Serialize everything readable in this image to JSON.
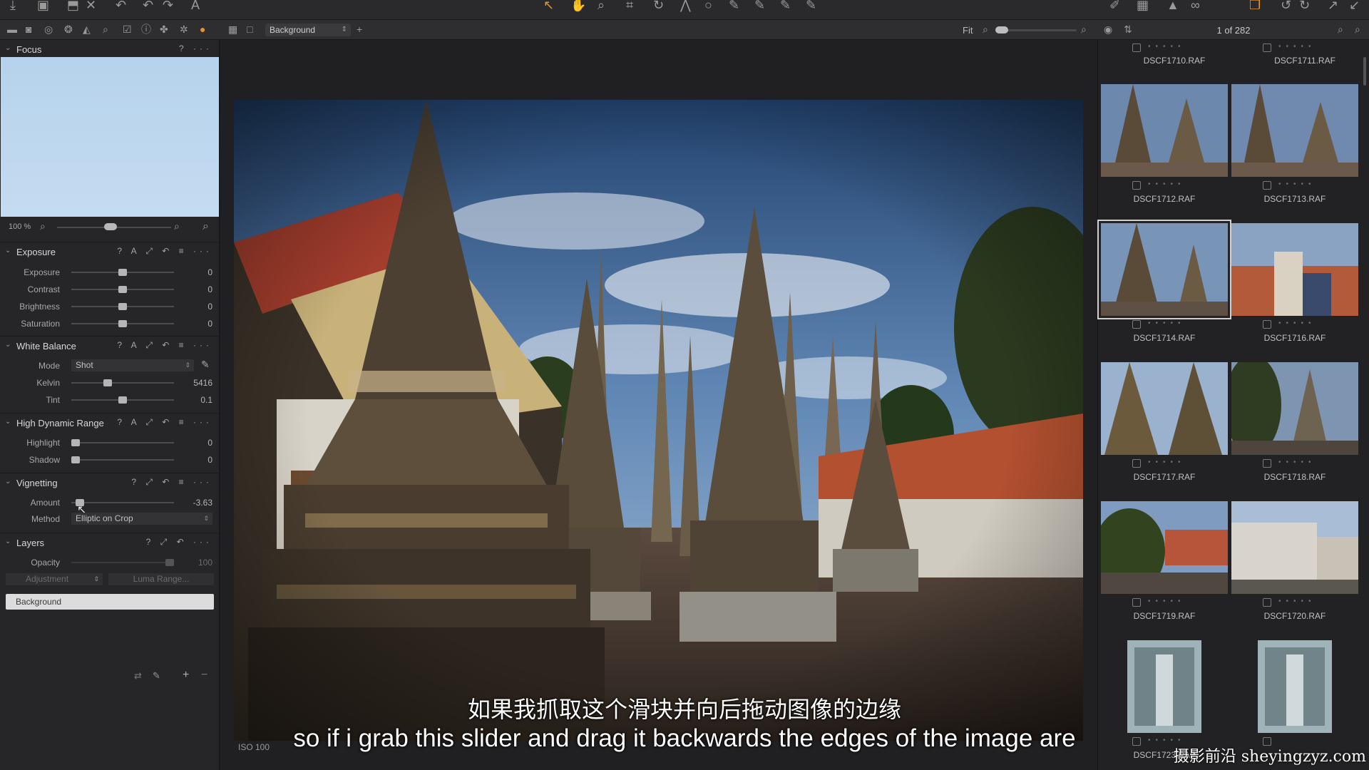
{
  "toolbar": {
    "layer_name": "Background",
    "fit_label": "Fit",
    "counter": "1 of 282"
  },
  "left_panel": {
    "focus": {
      "title": "Focus",
      "tools": "? ···",
      "zoom_value": "100 %"
    },
    "exposure": {
      "title": "Exposure",
      "tools": "? A ⤢ ↶ ≡ ···",
      "rows": [
        {
          "label": "Exposure",
          "value": "0"
        },
        {
          "label": "Contrast",
          "value": "0"
        },
        {
          "label": "Brightness",
          "value": "0"
        },
        {
          "label": "Saturation",
          "value": "0"
        }
      ]
    },
    "white_balance": {
      "title": "White Balance",
      "tools": "? A ⤢ ↶ ≡ ···",
      "mode_label": "Mode",
      "mode_value": "Shot",
      "kelvin_label": "Kelvin",
      "kelvin_value": "5416",
      "tint_label": "Tint",
      "tint_value": "0.1"
    },
    "hdr": {
      "title": "High Dynamic Range",
      "tools": "? A ⤢ ↶ ≡ ···",
      "highlight_label": "Highlight",
      "highlight_value": "0",
      "shadow_label": "Shadow",
      "shadow_value": "0"
    },
    "vignetting": {
      "title": "Vignetting",
      "tools": "? ⤢ ↶ ≡ ···",
      "amount_label": "Amount",
      "amount_value": "-3.63",
      "method_label": "Method",
      "method_value": "Elliptic on Crop"
    },
    "layers": {
      "title": "Layers",
      "tools": "? ⤢ ↶ ···",
      "opacity_label": "Opacity",
      "opacity_value": "100",
      "adjustment_label": "Adjustment",
      "luma_label": "Luma Range...",
      "background_item": "Background"
    }
  },
  "viewer": {
    "exif": "ISO 100"
  },
  "browser": {
    "top_names": [
      "DSCF1710.RAF",
      "DSCF1711.RAF"
    ],
    "thumbs": [
      {
        "name": "DSCF1712.RAF"
      },
      {
        "name": "DSCF1713.RAF"
      },
      {
        "name": "DSCF1714.RAF"
      },
      {
        "name": "DSCF1716.RAF"
      },
      {
        "name": "DSCF1717.RAF"
      },
      {
        "name": "DSCF1718.RAF"
      },
      {
        "name": "DSCF1719.RAF"
      },
      {
        "name": "DSCF1720.RAF"
      },
      {
        "name": "DSCF1723.RAF"
      },
      {
        "name": ""
      }
    ]
  },
  "subtitles": {
    "chinese": "如果我抓取这个滑块并向后拖动图像的边缘",
    "english": "so if i grab this slider and drag it backwards the edges of the image are"
  },
  "watermark": "摄影前沿 sheyingzyz.com"
}
